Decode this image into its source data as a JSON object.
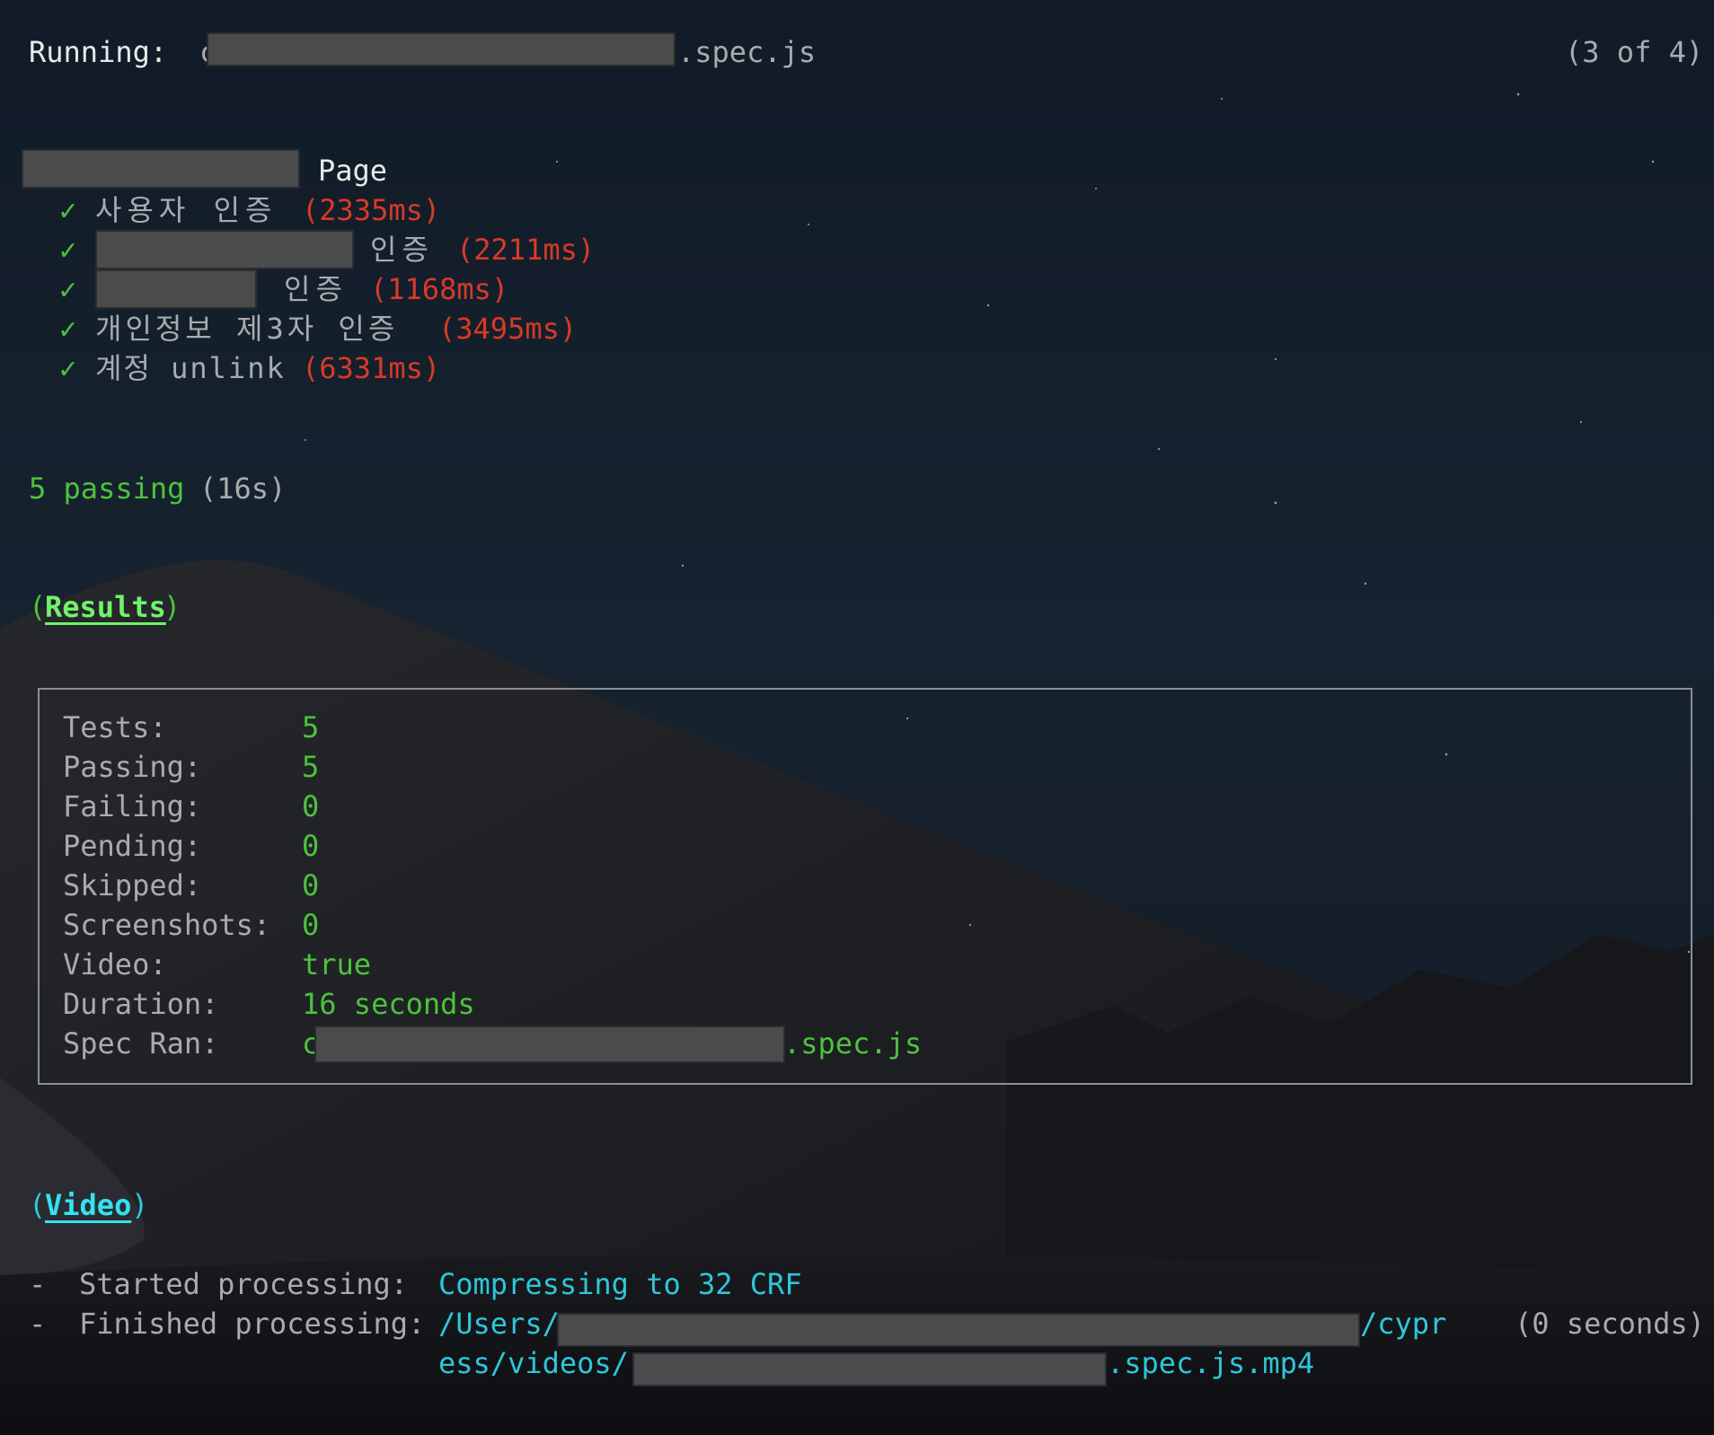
{
  "colors": {
    "green": "#4cc33c",
    "bright_green": "#72f26a",
    "red": "#d83a26",
    "gray": "#a9abae",
    "white": "#e9e9e9",
    "cyan": "#2fc6d8",
    "redaction": "#4a4b4d"
  },
  "header": {
    "running_label": "Running:",
    "spec_prefix": "c",
    "spec_suffix": ".spec.js",
    "progress": "(3 of 4)"
  },
  "suite": {
    "title_suffix": "Page",
    "check_glyph": "✓",
    "tests": [
      {
        "label": "사용자 인증",
        "duration": "(2335ms)"
      },
      {
        "label": "인증",
        "duration": "(2211ms)"
      },
      {
        "label": "인증",
        "duration": "(1168ms)"
      },
      {
        "label": "개인정보 제3자 인증",
        "duration": "(3495ms)"
      },
      {
        "label": "계정 unlink",
        "duration": "(6331ms)"
      }
    ],
    "summary_count": "5 passing",
    "summary_time": "(16s)"
  },
  "results": {
    "open_paren": "(",
    "title": "Results",
    "close_paren": ")",
    "rows": [
      {
        "key": "Tests:",
        "value": "5"
      },
      {
        "key": "Passing:",
        "value": "5"
      },
      {
        "key": "Failing:",
        "value": "0"
      },
      {
        "key": "Pending:",
        "value": "0"
      },
      {
        "key": "Skipped:",
        "value": "0"
      },
      {
        "key": "Screenshots:",
        "value": "0"
      },
      {
        "key": "Video:",
        "value": "true"
      },
      {
        "key": "Duration:",
        "value": "16 seconds"
      },
      {
        "key": "Spec Ran:",
        "value": "c",
        "suffix": ".spec.js"
      }
    ]
  },
  "video": {
    "open_paren": "(",
    "title": "Video",
    "close_paren": ")",
    "started_dash": "-",
    "started_label": "Started processing:",
    "started_value": "Compressing to 32 CRF",
    "finished_dash": "-",
    "finished_label": "Finished processing:",
    "finished_path_prefix": "/Users/",
    "finished_path_mid": "/cypr",
    "finished_path_line2_prefix": "ess/videos/",
    "finished_path_line2_suffix": ".spec.js.mp4",
    "finished_time": "(0 seconds)"
  }
}
